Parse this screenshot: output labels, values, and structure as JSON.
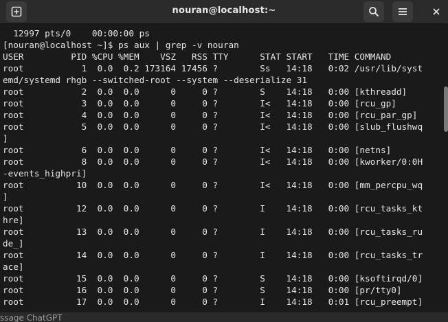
{
  "window": {
    "title": "nouran@localhost:~"
  },
  "icons": {
    "new_tab": "new-tab-icon",
    "search": "search-icon",
    "menu": "hamburger-menu-icon",
    "close": "close-icon"
  },
  "terminal": {
    "lines": [
      "  12997 pts/0    00:00:00 ps",
      "[nouran@localhost ~]$ ps aux | grep -v nouran",
      "USER         PID %CPU %MEM    VSZ   RSS TTY      STAT START   TIME COMMAND",
      "root           1  0.0  0.2 173164 17456 ?        Ss   14:18   0:02 /usr/lib/syst",
      "emd/systemd rhgb --switched-root --system --deserialize 31",
      "root           2  0.0  0.0      0     0 ?        S    14:18   0:00 [kthreadd]",
      "root           3  0.0  0.0      0     0 ?        I<   14:18   0:00 [rcu_gp]",
      "root           4  0.0  0.0      0     0 ?        I<   14:18   0:00 [rcu_par_gp]",
      "root           5  0.0  0.0      0     0 ?        I<   14:18   0:00 [slub_flushwq",
      "]",
      "root           6  0.0  0.0      0     0 ?        I<   14:18   0:00 [netns]",
      "root           8  0.0  0.0      0     0 ?        I<   14:18   0:00 [kworker/0:0H",
      "-events_highpri]",
      "root          10  0.0  0.0      0     0 ?        I<   14:18   0:00 [mm_percpu_wq",
      "]",
      "root          12  0.0  0.0      0     0 ?        I    14:18   0:00 [rcu_tasks_kt",
      "hre]",
      "root          13  0.0  0.0      0     0 ?        I    14:18   0:00 [rcu_tasks_ru",
      "de_]",
      "root          14  0.0  0.0      0     0 ?        I    14:18   0:00 [rcu_tasks_tr",
      "ace]",
      "root          15  0.0  0.0      0     0 ?        S    14:18   0:00 [ksoftirqd/0]",
      "root          16  0.0  0.0      0     0 ?        S    14:18   0:00 [pr/tty0]",
      "root          17  0.0  0.0      0     0 ?        I    14:18   0:01 [rcu_preempt]"
    ]
  },
  "below": {
    "text": "ssage ChatGPT"
  }
}
